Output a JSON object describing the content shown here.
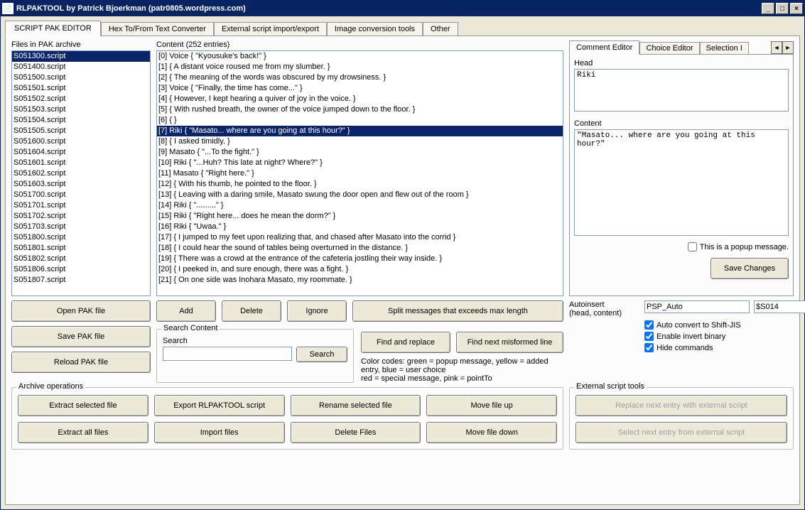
{
  "window": {
    "title": "RLPAKTOOL by Patrick Bjoerkman (patr0805.wordpress.com)"
  },
  "tabs": [
    "SCRIPT PAK EDITOR",
    "Hex To/From Text Converter",
    "External script import/export",
    "Image conversion tools",
    "Other"
  ],
  "filesLabel": "Files in PAK archive",
  "contentLabel": "Content (252 entries)",
  "files": [
    "S051300.script",
    "S051400.script",
    "S051500.script",
    "S051501.script",
    "S051502.script",
    "S051503.script",
    "S051504.script",
    "S051505.script",
    "S051600.script",
    "S051604.script",
    "S051601.script",
    "S051602.script",
    "S051603.script",
    "S051700.script",
    "S051701.script",
    "S051702.script",
    "S051703.script",
    "S051800.script",
    "S051801.script",
    "S051802.script",
    "S051806.script",
    "S051807.script"
  ],
  "filesSelectedIndex": 0,
  "entries": [
    "[0] Voice { \"Kyousuke's back!\" }",
    "[1]  { A distant voice roused me from my slumber. }",
    "[2]  { The meaning of the words was obscured by my drowsiness. }",
    "[3] Voice { \"Finally, the time has come...\" }",
    "[4]  { However, I kept hearing a quiver of joy in the voice. }",
    "[5]  { With rushed breath, the owner of the voice jumped down to the floor. }",
    "[6]  {  }",
    "[7] Riki { \"Masato... where are you going at this hour?\" }",
    "[8]  { I asked timidly. }",
    "[9] Masato { \"...To the fight.\" }",
    "[10] Riki { \"...Huh? This late at night? Where?\" }",
    "[11] Masato { \"Right here.\" }",
    "[12]  { With his thumb, he pointed to the floor. }",
    "[13]  { Leaving with a daring smile, Masato swung the door open and flew out of the room }",
    "[14] Riki { \".........\" }",
    "[15] Riki { \"Right here... does he mean the dorm?\" }",
    "[16] Riki { \"Uwaa.\" }",
    "[17]  { I jumped to my feet upon realizing that, and chased after Masato into the corrid }",
    "[18]  { I could hear the sound of tables being overturned in the distance. }",
    "[19]  { There was a crowd at the entrance of the cafeteria jostling their way inside. }",
    "[20]  { I peeked in, and sure enough, there was a fight. }",
    "[21]  { On one side was Inohara Masato, my roommate. }"
  ],
  "entriesSelectedIndex": 7,
  "buttons": {
    "openPak": "Open PAK file",
    "savePak": "Save PAK file",
    "reloadPak": "Reload PAK file",
    "add": "Add",
    "delete": "Delete",
    "ignore": "Ignore",
    "split": "Split messages that exceeds max length",
    "findReplace": "Find and replace",
    "findMisformed": "Find next misformed line",
    "search": "Search",
    "saveChanges": "Save Changes",
    "extractSelected": "Extract selected file",
    "extractAll": "Extract all files",
    "exportScript": "Export RLPAKTOOL script",
    "importFiles": "Import files",
    "renameFile": "Rename selected file",
    "deleteFiles": "Delete Files",
    "moveUp": "Move file up",
    "moveDown": "Move file down",
    "replaceExternal": "Replace next entry with external script",
    "selectExternal": "Select next entry from external script"
  },
  "searchGroup": {
    "legend": "Search Content",
    "searchLabel": "Search",
    "value": ""
  },
  "colorHelp1": "Color codes: green = popup message,  yellow = added entry,   blue = user choice",
  "colorHelp2": "red = special message, pink = pointTo",
  "editorTabs": [
    "Comment Editor",
    "Choice Editor",
    "Selection I"
  ],
  "editor": {
    "headLabel": "Head",
    "headValue": "Riki",
    "contentLabel": "Content",
    "contentValue": "\"Masato... where are you going at this hour?\"",
    "popupLabel": "This is a popup message."
  },
  "autoinsert": {
    "label": "Autoinsert\n(head, content)",
    "label1": "Autoinsert",
    "label2": "(head, content)",
    "field1": "PSP_Auto",
    "field2": "$S014",
    "cbShiftJis": "Auto convert to Shift-JIS",
    "cbInvert": "Enable invert binary",
    "cbHide": "Hide commands"
  },
  "archiveGroup": "Archive operations",
  "externalGroup": "External script tools"
}
